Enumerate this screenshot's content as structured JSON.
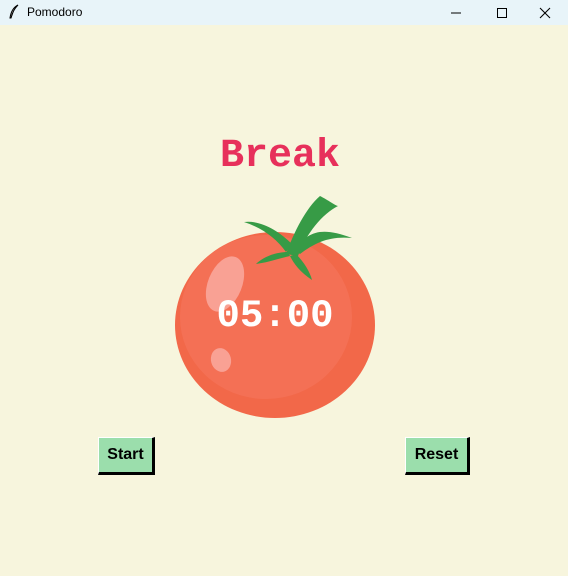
{
  "window": {
    "title": "Pomodoro",
    "app_icon": "feather-icon",
    "controls": [
      "minimize-icon",
      "maximize-icon",
      "close-icon"
    ]
  },
  "main": {
    "heading": "Break",
    "timer": "05:00",
    "image": "tomato-image"
  },
  "buttons": {
    "start_label": "Start",
    "reset_label": "Reset"
  },
  "colors": {
    "background": "#f7f5dd",
    "heading": "#e7305b",
    "button": "#9bdeac",
    "tomato": "#f26849",
    "leaves": "#379b46",
    "timer_text": "#ffffff"
  }
}
